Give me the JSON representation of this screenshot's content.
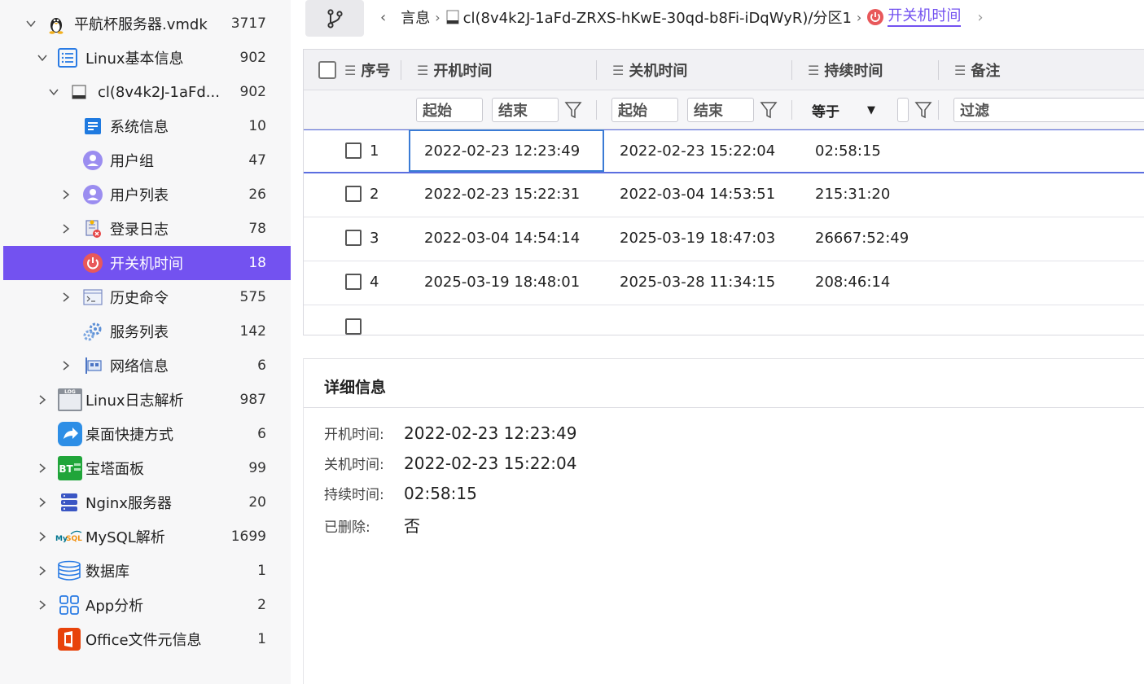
{
  "sidebar": {
    "items": [
      {
        "label": "平航杯服务器.vmdk",
        "count": "3717"
      },
      {
        "label": "Linux基本信息",
        "count": "902"
      },
      {
        "label": "cl(8v4k2J-1aFd...",
        "count": "902"
      },
      {
        "label": "系统信息",
        "count": "10"
      },
      {
        "label": "用户组",
        "count": "47"
      },
      {
        "label": "用户列表",
        "count": "26"
      },
      {
        "label": "登录日志",
        "count": "78"
      },
      {
        "label": "开关机时间",
        "count": "18"
      },
      {
        "label": "历史命令",
        "count": "575"
      },
      {
        "label": "服务列表",
        "count": "142"
      },
      {
        "label": "网络信息",
        "count": "6"
      },
      {
        "label": "Linux日志解析",
        "count": "987"
      },
      {
        "label": "桌面快捷方式",
        "count": "6"
      },
      {
        "label": "宝塔面板",
        "count": "99"
      },
      {
        "label": "Nginx服务器",
        "count": "20"
      },
      {
        "label": "MySQL解析",
        "count": "1699"
      },
      {
        "label": "数据库",
        "count": "1"
      },
      {
        "label": "App分析",
        "count": "2"
      },
      {
        "label": "Office文件元信息",
        "count": "1"
      }
    ]
  },
  "breadcrumb": {
    "part1": "言息",
    "part2": "cl(8v4k2J-1aFd-ZRXS-hKwE-30qd-b8Fi-iDqWyR)/分区1",
    "current": "开关机时间"
  },
  "table": {
    "columns": [
      "序号",
      "开机时间",
      "关机时间",
      "持续时间",
      "备注"
    ],
    "filters": {
      "start": "起始",
      "end": "结束",
      "equals": "等于",
      "filter": "过滤"
    },
    "rows": [
      {
        "idx": "1",
        "start": "2022-02-23 12:23:49",
        "end": "2022-02-23 15:22:04",
        "duration": "02:58:15"
      },
      {
        "idx": "2",
        "start": "2022-02-23 15:22:31",
        "end": "2022-03-04 14:53:51",
        "duration": "215:31:20"
      },
      {
        "idx": "3",
        "start": "2022-03-04 14:54:14",
        "end": "2025-03-19 18:47:03",
        "duration": "26667:52:49"
      },
      {
        "idx": "4",
        "start": "2025-03-19 18:48:01",
        "end": "2025-03-28 11:34:15",
        "duration": "208:46:14"
      }
    ]
  },
  "detail": {
    "title": "详细信息",
    "fields": [
      {
        "key": "开机时间:",
        "value": "2022-02-23 12:23:49"
      },
      {
        "key": "关机时间:",
        "value": "2022-02-23 15:22:04"
      },
      {
        "key": "持续时间:",
        "value": "02:58:15"
      },
      {
        "key": "已删除:",
        "value": "否"
      }
    ]
  },
  "colors": {
    "accent": "#7352f0",
    "selection_border": "#5b6ee0",
    "power_icon": "#e8585a"
  }
}
